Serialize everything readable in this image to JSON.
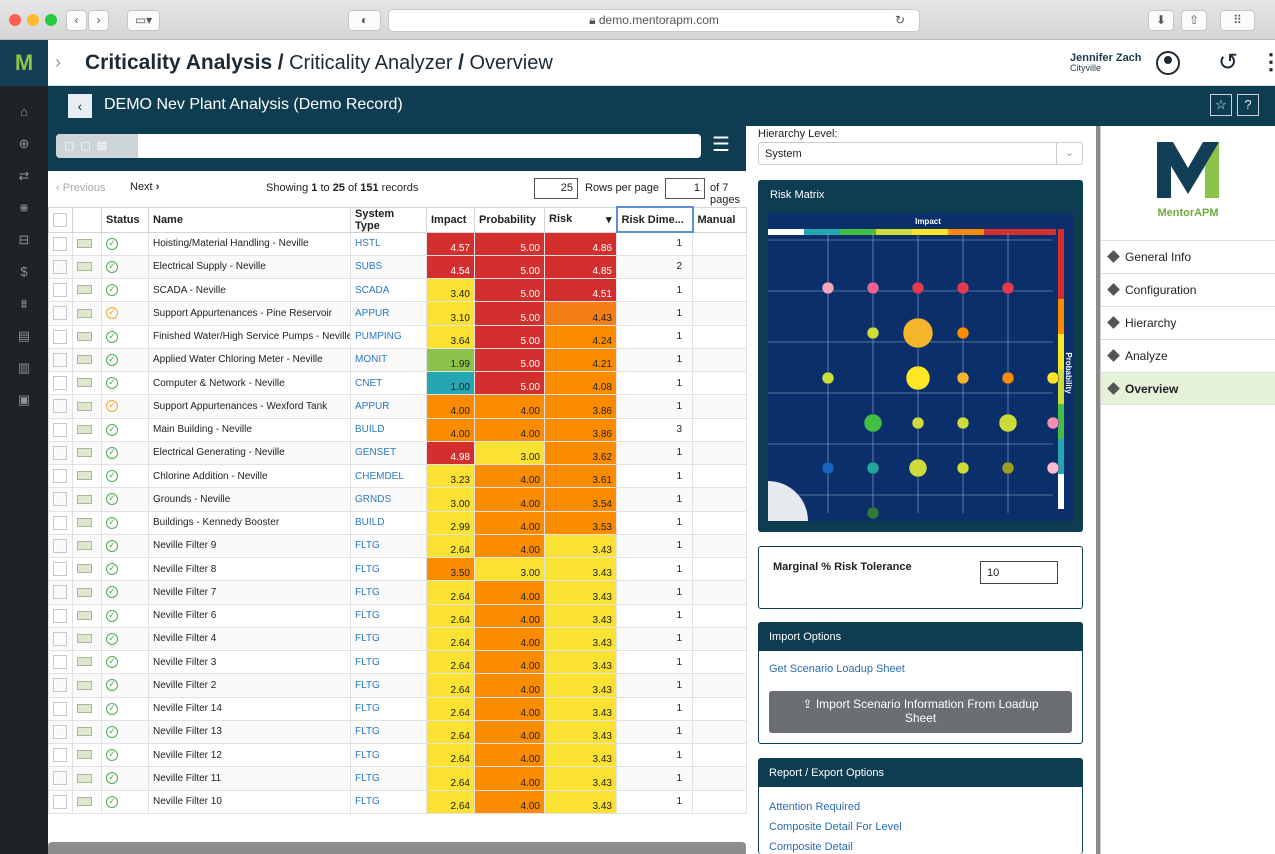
{
  "browser": {
    "url": "demo.mentorapm.com"
  },
  "app": {
    "logo": "M",
    "breadcrumb": {
      "module": "Criticality Analysis",
      "sep1": "/",
      "sub": "Criticality Analyzer",
      "sep2": "/",
      "page": "Overview"
    },
    "user": {
      "name": "Jennifer Zach",
      "org": "Cityville"
    }
  },
  "record": {
    "title": "DEMO Nev Plant Analysis (Demo Record)"
  },
  "pager": {
    "prev": "Previous",
    "next": "Next",
    "showing_pre": "Showing ",
    "from": "1",
    "to_word": " to ",
    "to": "25",
    "of_word": " of ",
    "total": "151",
    "records_word": " records",
    "rows_per_page": "25",
    "rows_label": "Rows per page",
    "page": "1",
    "of_pages": "of 7 pages"
  },
  "table": {
    "headers": {
      "status": "Status",
      "name": "Name",
      "system_type": "System Type",
      "impact": "Impact",
      "probability": "Probability",
      "risk": "Risk",
      "risk_dim": "Risk Dime...",
      "manual": "Manual"
    },
    "rows": [
      {
        "name": "Hoisting/Material Handling - Neville",
        "sys": "HSTL",
        "impact": "4.57",
        "prob": "5.00",
        "risk": "4.86",
        "dim": "1",
        "ic": "#d32f2f",
        "pc": "#d32f2f",
        "rc": "#d32f2f",
        "st": "ok"
      },
      {
        "name": "Electrical Supply - Neville",
        "sys": "SUBS",
        "impact": "4.54",
        "prob": "5.00",
        "risk": "4.85",
        "dim": "2",
        "ic": "#d32f2f",
        "pc": "#d32f2f",
        "rc": "#d32f2f",
        "st": "ok"
      },
      {
        "name": "SCADA - Neville",
        "sys": "SCADA",
        "impact": "3.40",
        "prob": "5.00",
        "risk": "4.51",
        "dim": "1",
        "ic": "#fbe232",
        "pc": "#d32f2f",
        "rc": "#d32f2f",
        "st": "ok"
      },
      {
        "name": "Support Appurtenances - Pine Reservoir",
        "sys": "APPUR",
        "impact": "3.10",
        "prob": "5.00",
        "risk": "4.43",
        "dim": "1",
        "ic": "#fbe232",
        "pc": "#d32f2f",
        "rc": "#f57f17",
        "st": "warn"
      },
      {
        "name": "Finished Water/High Service Pumps - Neville",
        "sys": "PUMPING",
        "impact": "3.64",
        "prob": "5.00",
        "risk": "4.24",
        "dim": "1",
        "ic": "#fbe232",
        "pc": "#d32f2f",
        "rc": "#fb8c00",
        "st": "ok"
      },
      {
        "name": "Applied Water Chloring Meter - Neville",
        "sys": "MONIT",
        "impact": "1.99",
        "prob": "5.00",
        "risk": "4.21",
        "dim": "1",
        "ic": "#8bc34a",
        "pc": "#d32f2f",
        "rc": "#fb8c00",
        "st": "ok"
      },
      {
        "name": "Computer & Network - Neville",
        "sys": "CNET",
        "impact": "1.00",
        "prob": "5.00",
        "risk": "4.08",
        "dim": "1",
        "ic": "#26a6b2",
        "pc": "#d32f2f",
        "rc": "#fb8c00",
        "st": "ok"
      },
      {
        "name": "Support Appurtenances - Wexford Tank",
        "sys": "APPUR",
        "impact": "4.00",
        "prob": "4.00",
        "risk": "3.86",
        "dim": "1",
        "ic": "#fb8c00",
        "pc": "#fb8c00",
        "rc": "#fb8c00",
        "st": "warn"
      },
      {
        "name": "Main Building - Neville",
        "sys": "BUILD",
        "impact": "4.00",
        "prob": "4.00",
        "risk": "3.86",
        "dim": "3",
        "ic": "#fb8c00",
        "pc": "#fb8c00",
        "rc": "#fb8c00",
        "st": "ok"
      },
      {
        "name": "Electrical Generating - Neville",
        "sys": "GENSET",
        "impact": "4.98",
        "prob": "3.00",
        "risk": "3.62",
        "dim": "1",
        "ic": "#d32f2f",
        "pc": "#fbe232",
        "rc": "#fb8c00",
        "st": "ok"
      },
      {
        "name": "Chlorine Addition - Neville",
        "sys": "CHEMDEL",
        "impact": "3.23",
        "prob": "4.00",
        "risk": "3.61",
        "dim": "1",
        "ic": "#fbe232",
        "pc": "#fb8c00",
        "rc": "#fb8c00",
        "st": "ok"
      },
      {
        "name": "Grounds - Neville",
        "sys": "GRNDS",
        "impact": "3.00",
        "prob": "4.00",
        "risk": "3.54",
        "dim": "1",
        "ic": "#fbe232",
        "pc": "#fb8c00",
        "rc": "#fb8c00",
        "st": "ok"
      },
      {
        "name": "Buildings - Kennedy Booster",
        "sys": "BUILD",
        "impact": "2.99",
        "prob": "4.00",
        "risk": "3.53",
        "dim": "1",
        "ic": "#fbe232",
        "pc": "#fb8c00",
        "rc": "#fb8c00",
        "st": "ok"
      },
      {
        "name": "Neville Filter 9",
        "sys": "FLTG",
        "impact": "2.64",
        "prob": "4.00",
        "risk": "3.43",
        "dim": "1",
        "ic": "#fbe232",
        "pc": "#fb8c00",
        "rc": "#fbe232",
        "st": "ok"
      },
      {
        "name": "Neville Filter 8",
        "sys": "FLTG",
        "impact": "3.50",
        "prob": "3.00",
        "risk": "3.43",
        "dim": "1",
        "ic": "#fb8c00",
        "pc": "#fbe232",
        "rc": "#fbe232",
        "st": "ok"
      },
      {
        "name": "Neville Filter 7",
        "sys": "FLTG",
        "impact": "2.64",
        "prob": "4.00",
        "risk": "3.43",
        "dim": "1",
        "ic": "#fbe232",
        "pc": "#fb8c00",
        "rc": "#fbe232",
        "st": "ok"
      },
      {
        "name": "Neville Filter 6",
        "sys": "FLTG",
        "impact": "2.64",
        "prob": "4.00",
        "risk": "3.43",
        "dim": "1",
        "ic": "#fbe232",
        "pc": "#fb8c00",
        "rc": "#fbe232",
        "st": "ok"
      },
      {
        "name": "Neville Filter 4",
        "sys": "FLTG",
        "impact": "2.64",
        "prob": "4.00",
        "risk": "3.43",
        "dim": "1",
        "ic": "#fbe232",
        "pc": "#fb8c00",
        "rc": "#fbe232",
        "st": "ok"
      },
      {
        "name": "Neville Filter 3",
        "sys": "FLTG",
        "impact": "2.64",
        "prob": "4.00",
        "risk": "3.43",
        "dim": "1",
        "ic": "#fbe232",
        "pc": "#fb8c00",
        "rc": "#fbe232",
        "st": "ok"
      },
      {
        "name": "Neville Filter 2",
        "sys": "FLTG",
        "impact": "2.64",
        "prob": "4.00",
        "risk": "3.43",
        "dim": "1",
        "ic": "#fbe232",
        "pc": "#fb8c00",
        "rc": "#fbe232",
        "st": "ok"
      },
      {
        "name": "Neville Filter 14",
        "sys": "FLTG",
        "impact": "2.64",
        "prob": "4.00",
        "risk": "3.43",
        "dim": "1",
        "ic": "#fbe232",
        "pc": "#fb8c00",
        "rc": "#fbe232",
        "st": "ok"
      },
      {
        "name": "Neville Filter 13",
        "sys": "FLTG",
        "impact": "2.64",
        "prob": "4.00",
        "risk": "3.43",
        "dim": "1",
        "ic": "#fbe232",
        "pc": "#fb8c00",
        "rc": "#fbe232",
        "st": "ok"
      },
      {
        "name": "Neville Filter 12",
        "sys": "FLTG",
        "impact": "2.64",
        "prob": "4.00",
        "risk": "3.43",
        "dim": "1",
        "ic": "#fbe232",
        "pc": "#fb8c00",
        "rc": "#fbe232",
        "st": "ok"
      },
      {
        "name": "Neville Filter 11",
        "sys": "FLTG",
        "impact": "2.64",
        "prob": "4.00",
        "risk": "3.43",
        "dim": "1",
        "ic": "#fbe232",
        "pc": "#fb8c00",
        "rc": "#fbe232",
        "st": "ok"
      },
      {
        "name": "Neville Filter 10",
        "sys": "FLTG",
        "impact": "2.64",
        "prob": "4.00",
        "risk": "3.43",
        "dim": "1",
        "ic": "#fbe232",
        "pc": "#fb8c00",
        "rc": "#fbe232",
        "st": "ok"
      }
    ]
  },
  "hierarchy": {
    "label": "Hierarchy Level:",
    "value": "System"
  },
  "risk_matrix": {
    "title": "Risk Matrix",
    "x_label": "Impact",
    "y_label": "Probability",
    "x_range": [
      1,
      5
    ],
    "y_range": [
      1,
      5
    ],
    "points": [
      {
        "impact": 1.5,
        "prob": 4.5,
        "size": 1,
        "color": "#f4a7b9"
      },
      {
        "impact": 2.0,
        "prob": 4.5,
        "size": 1,
        "color": "#f06292"
      },
      {
        "impact": 2.5,
        "prob": 4.5,
        "size": 1,
        "color": "#e53950"
      },
      {
        "impact": 3.0,
        "prob": 4.5,
        "size": 1,
        "color": "#e53950"
      },
      {
        "impact": 3.5,
        "prob": 4.5,
        "size": 1,
        "color": "#e53950"
      },
      {
        "impact": 2.0,
        "prob": 4.0,
        "size": 1,
        "color": "#cddc39"
      },
      {
        "impact": 2.5,
        "prob": 4.0,
        "size": 4,
        "color": "#f5b52a"
      },
      {
        "impact": 3.0,
        "prob": 4.0,
        "size": 1,
        "color": "#fb8c00"
      },
      {
        "impact": 1.5,
        "prob": 3.5,
        "size": 1,
        "color": "#cddc39"
      },
      {
        "impact": 2.5,
        "prob": 3.5,
        "size": 3,
        "color": "#fde725"
      },
      {
        "impact": 3.0,
        "prob": 3.5,
        "size": 1,
        "color": "#f5b52a"
      },
      {
        "impact": 3.5,
        "prob": 3.5,
        "size": 1,
        "color": "#fb8c00"
      },
      {
        "impact": 4.0,
        "prob": 3.5,
        "size": 1,
        "color": "#fde725"
      },
      {
        "impact": 2.0,
        "prob": 3.0,
        "size": 2,
        "color": "#43c043"
      },
      {
        "impact": 2.5,
        "prob": 3.0,
        "size": 1,
        "color": "#cddc39"
      },
      {
        "impact": 3.0,
        "prob": 3.0,
        "size": 1,
        "color": "#cddc39"
      },
      {
        "impact": 3.5,
        "prob": 3.0,
        "size": 2,
        "color": "#cddc39"
      },
      {
        "impact": 4.0,
        "prob": 3.0,
        "size": 1,
        "color": "#f48fb1"
      },
      {
        "impact": 1.5,
        "prob": 2.5,
        "size": 1,
        "color": "#1565c0"
      },
      {
        "impact": 2.0,
        "prob": 2.5,
        "size": 1,
        "color": "#26a69a"
      },
      {
        "impact": 2.5,
        "prob": 2.5,
        "size": 2,
        "color": "#cddc39"
      },
      {
        "impact": 3.0,
        "prob": 2.5,
        "size": 1,
        "color": "#cddc39"
      },
      {
        "impact": 3.5,
        "prob": 2.5,
        "size": 1,
        "color": "#9e9d24"
      },
      {
        "impact": 4.0,
        "prob": 2.5,
        "size": 1,
        "color": "#f8bbd0"
      },
      {
        "impact": 2.0,
        "prob": 2.0,
        "size": 1,
        "color": "#2e7d32"
      }
    ]
  },
  "tolerance": {
    "label": "Marginal % Risk Tolerance",
    "value": "10"
  },
  "import": {
    "title": "Import Options",
    "link": "Get Scenario Loadup Sheet",
    "button": "Import Scenario Information From Loadup Sheet"
  },
  "export": {
    "title": "Report / Export Options",
    "links": [
      "Attention Required",
      "Composite Detail For Level",
      "Composite Detail"
    ]
  },
  "brand": {
    "name": "MentorAPM",
    "mark": "M"
  },
  "nav": [
    "General Info",
    "Configuration",
    "Hierarchy",
    "Analyze",
    "Overview"
  ]
}
